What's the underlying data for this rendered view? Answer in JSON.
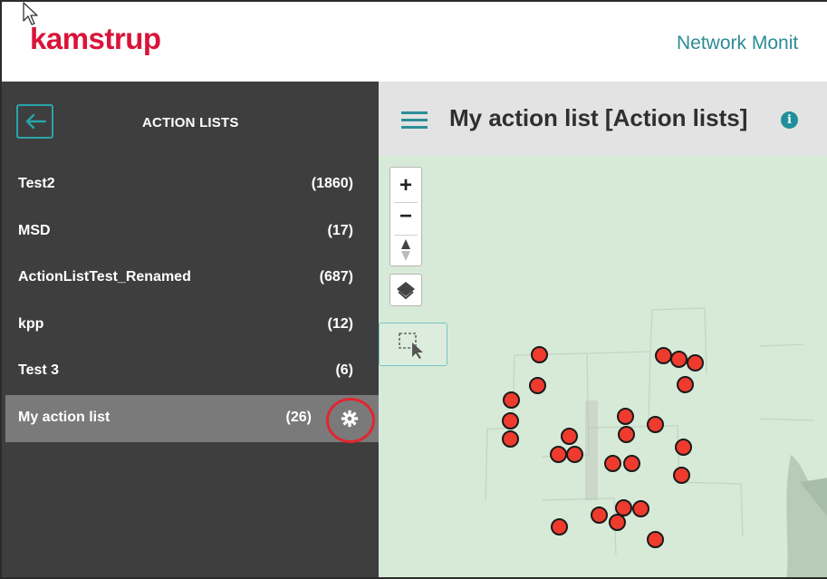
{
  "header": {
    "logo_text": "kamstrup",
    "title": "Network Monit"
  },
  "sidebar": {
    "title": "ACTION LISTS",
    "back_icon": "arrow-left-icon",
    "items": [
      {
        "label": "Test2",
        "count": "(1860)"
      },
      {
        "label": "MSD",
        "count": "(17)"
      },
      {
        "label": "ActionListTest_Renamed",
        "count": "(687)"
      },
      {
        "label": "kpp",
        "count": "(12)"
      },
      {
        "label": "Test 3",
        "count": "(6)"
      },
      {
        "label": "My action list",
        "count": "(26)",
        "active": true
      }
    ]
  },
  "main": {
    "title": "My action list [Action lists]",
    "info_icon": "i",
    "map_controls": {
      "zoom_in": "+",
      "zoom_out": "−"
    }
  },
  "colors": {
    "brand": "#d9143a",
    "accent": "#2a8f99",
    "sidebar_bg": "#3e3e3e",
    "active_item_bg": "#7a7a7a",
    "marker": "#ef3b2e",
    "highlight_circle": "#e0262f",
    "map_bg": "#d7ead7"
  }
}
